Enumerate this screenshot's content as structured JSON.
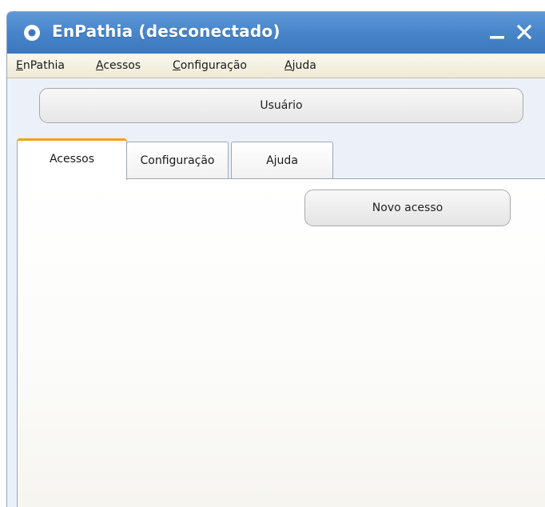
{
  "window": {
    "title": "EnPathia (desconectado)",
    "app_icon": "app-ring-icon",
    "minimize_icon": "minimize-icon",
    "close_icon": "close-icon"
  },
  "menubar": {
    "items": [
      {
        "label": "EnPathia",
        "mnemonic": "E"
      },
      {
        "label": "Acessos",
        "mnemonic": "A"
      },
      {
        "label": "Configuração",
        "mnemonic": "C"
      },
      {
        "label": "Ajuda",
        "mnemonic": "A"
      }
    ]
  },
  "user_button": {
    "label": "Usuário"
  },
  "tabs": [
    {
      "label": "Acessos",
      "active": true
    },
    {
      "label": "Configuração",
      "active": false
    },
    {
      "label": "Ajuda",
      "active": false
    }
  ],
  "panel": {
    "new_access_button": {
      "label": "Novo acesso"
    }
  },
  "colors": {
    "titlebar": "#4a86cb",
    "active_tab_accent": "#f0a21e",
    "menubar": "#f4f0e2"
  }
}
